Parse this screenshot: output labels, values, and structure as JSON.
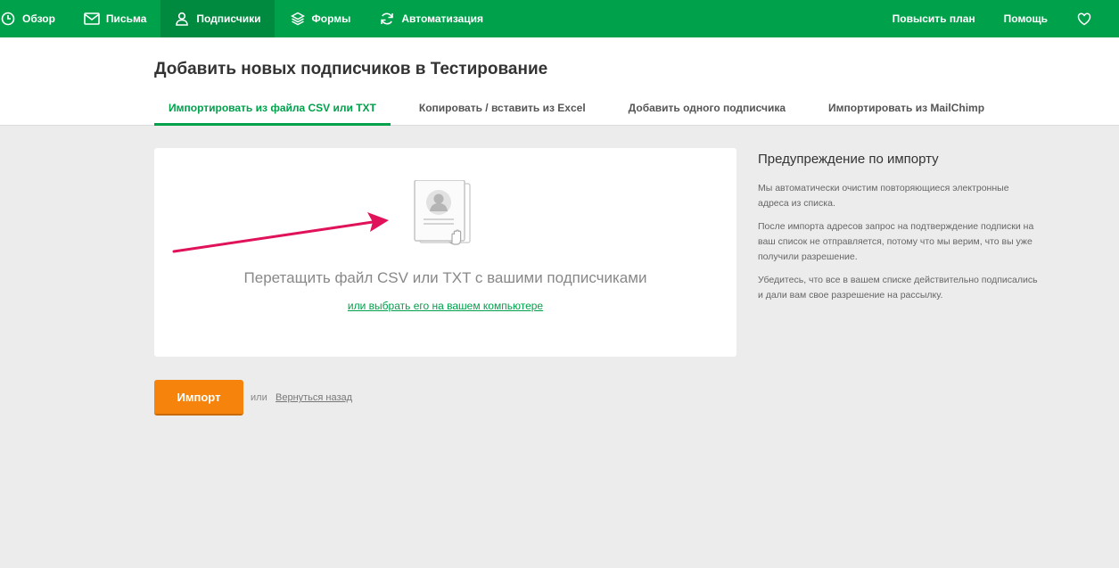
{
  "nav": {
    "items": [
      {
        "label": "Обзор",
        "icon": "clock-icon"
      },
      {
        "label": "Письма",
        "icon": "envelope-icon"
      },
      {
        "label": "Подписчики",
        "icon": "user-icon",
        "active": true
      },
      {
        "label": "Формы",
        "icon": "layers-icon"
      },
      {
        "label": "Автоматизация",
        "icon": "refresh-icon"
      }
    ],
    "right": {
      "upgrade_label": "Повысить план",
      "help_label": "Помощь",
      "favorite_icon": "heart-icon"
    }
  },
  "page": {
    "title": "Добавить новых подписчиков в Тестирование"
  },
  "tabs": [
    {
      "label": "Импортировать из файла CSV или TXT",
      "active": true
    },
    {
      "label": "Копировать / вставить из Excel"
    },
    {
      "label": "Добавить одного подписчика"
    },
    {
      "label": "Импортировать из MailChimp"
    }
  ],
  "dropzone": {
    "text": "Перетащить файл CSV или TXT с вашими подписчиками",
    "link": "или выбрать его на вашем компьютере",
    "illustration_icon": "contact-card-drag-icon"
  },
  "actions": {
    "import_label": "Импорт",
    "or_label": "или",
    "back_label": "Вернуться назад"
  },
  "sidebar": {
    "title": "Предупреждение по импорту",
    "paragraphs": [
      "Мы автоматически очистим повторяющиеся электронные адреса из списка.",
      "После импорта адресов запрос на подтверждение подписки на ваш список не отправляется, потому что мы верим, что вы уже получили разрешение.",
      "Убедитесь, что все в вашем списке действительно подписались и дали вам свое разрешение на рассылку."
    ]
  },
  "colors": {
    "brand_green": "#00a14b",
    "active_nav": "#008a40",
    "import_orange": "#f5830c",
    "annotation_arrow": "#e0125a"
  }
}
